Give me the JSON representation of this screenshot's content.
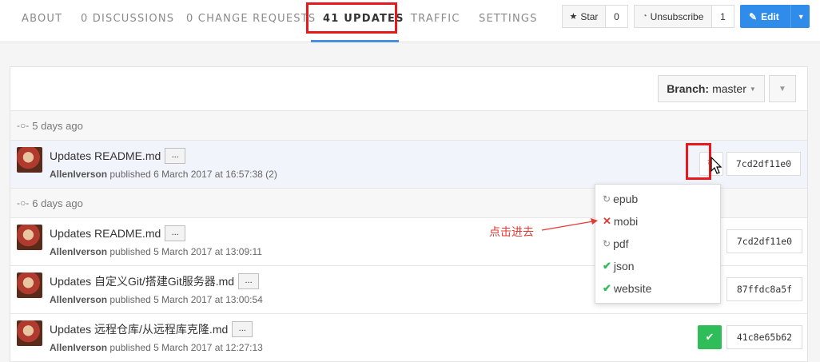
{
  "nav": {
    "tabs": [
      {
        "label": "ABOUT"
      },
      {
        "label": "0 DISCUSSIONS"
      },
      {
        "label": "0 CHANGE REQUESTS"
      },
      {
        "label": "41 UPDATES"
      },
      {
        "label": "TRAFFIC"
      },
      {
        "label": "SETTINGS"
      }
    ],
    "active_tab": "41 UPDATES",
    "star_label": "Star",
    "star_count": "0",
    "unsubscribe_label": "Unsubscribe",
    "unsubscribe_count": "1",
    "edit_label": "Edit"
  },
  "branch": {
    "label": "Branch:",
    "value": "master"
  },
  "groups": [
    {
      "date": "5 days ago",
      "rows": [
        {
          "title": "Updates README.md",
          "author": "AllenIverson",
          "meta": " published 6 March 2017 at 16:57:38 (2)",
          "sha": "7cd2df11e0",
          "status": "pending"
        }
      ]
    },
    {
      "date": "6 days ago",
      "rows": [
        {
          "title": "Updates README.md",
          "author": "AllenIverson",
          "meta": " published 5 March 2017 at 13:09:11",
          "sha": "7cd2df11e0",
          "status": "none"
        },
        {
          "title": "Updates 自定义Git/搭建Git服务器.md",
          "author": "AllenIverson",
          "meta": " published 5 March 2017 at 13:00:54",
          "sha": "87ffdc8a5f",
          "status": "none"
        },
        {
          "title": "Updates 远程仓库/从远程库克隆.md",
          "author": "AllenIverson",
          "meta": " published 5 March 2017 at 12:27:13",
          "sha": "41c8e65b62",
          "status": "success"
        }
      ]
    }
  ],
  "ellipsis_label": "...",
  "dropdown": [
    {
      "label": "epub",
      "state": "pending"
    },
    {
      "label": "mobi",
      "state": "failed"
    },
    {
      "label": "pdf",
      "state": "pending"
    },
    {
      "label": "json",
      "state": "ok"
    },
    {
      "label": "website",
      "state": "ok"
    }
  ],
  "annotation": "点击进去",
  "colors": {
    "accent": "#2f8cea",
    "highlight_box": "#e8181b",
    "success": "#2ebd59",
    "failure": "#e53935"
  }
}
